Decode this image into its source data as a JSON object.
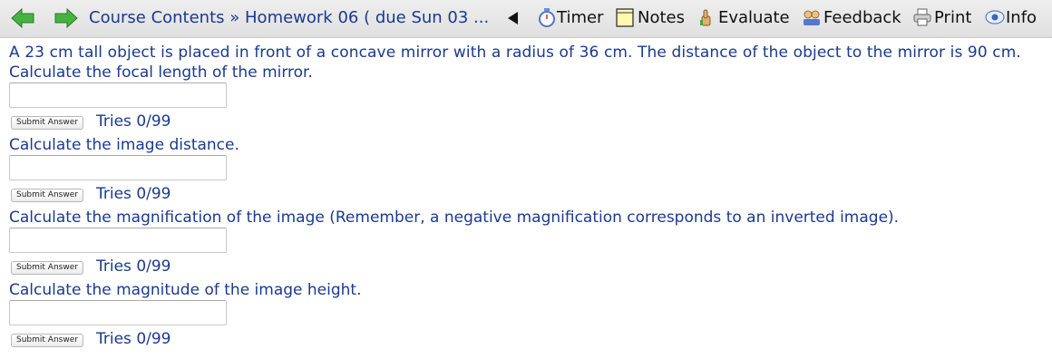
{
  "nav": {
    "back_icon": "left-arrow-icon",
    "forward_icon": "right-arrow-icon",
    "breadcrumb_root": "Course Contents",
    "breadcrumb_sep": "»",
    "breadcrumb_current": "Homework 06 ( due Sun 03 ..."
  },
  "toolbar": {
    "timer": "Timer",
    "notes": "Notes",
    "evaluate": "Evaluate",
    "feedback": "Feedback",
    "print": "Print",
    "info": "Info"
  },
  "problem": {
    "statement": "A 23 cm tall object is placed in front of a concave mirror with a radius of 36 cm. The distance of the object to the mirror is 90 cm.",
    "parts": [
      {
        "question": "Calculate the focal length of the mirror.",
        "input_value": "",
        "submit_label": "Submit Answer",
        "tries": "Tries 0/99"
      },
      {
        "question": "Calculate the image distance.",
        "input_value": "",
        "submit_label": "Submit Answer",
        "tries": "Tries 0/99"
      },
      {
        "question": "Calculate the magnification of the image (Remember, a negative magnification corresponds to an inverted image).",
        "input_value": "",
        "submit_label": "Submit Answer",
        "tries": "Tries 0/99"
      },
      {
        "question": "Calculate the magnitude of the image height.",
        "input_value": "",
        "submit_label": "Submit Answer",
        "tries": "Tries 0/99"
      }
    ]
  },
  "colors": {
    "text": "#1b3a8f",
    "arrow_green": "#3fae3a",
    "toolbar_bg": "#e6e6e6"
  }
}
